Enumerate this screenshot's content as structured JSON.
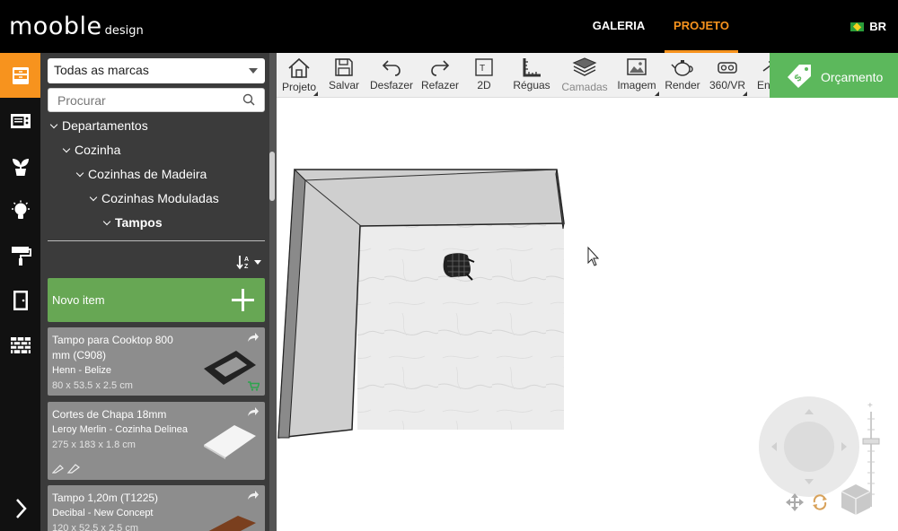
{
  "brand": {
    "logo": "mooble",
    "logo_sub": "design"
  },
  "nav": {
    "gallery": "GALERIA",
    "project": "PROJETO",
    "lang": "BR"
  },
  "catalog": {
    "brand_filter": "Todas as marcas",
    "search_placeholder": "Procurar",
    "tree": [
      "Departamentos",
      "Cozinha",
      "Cozinhas de Madeira",
      "Cozinhas Moduladas",
      "Tampos"
    ],
    "new_item": "Novo item",
    "products": [
      {
        "name": "Tampo para Cooktop 800 mm (C908)",
        "brand": "Henn - Belize",
        "dims": "80 x 53.5 x 2.5 cm"
      },
      {
        "name": "Cortes de Chapa 18mm",
        "brand": "Leroy Merlin - Cozinha Delinea",
        "dims": "275 x 183 x 1.8 cm"
      },
      {
        "name": "Tampo 1,20m (T1225)",
        "brand": "Decibal - New Concept",
        "dims": "120 x 52.5 x 2.5 cm"
      }
    ]
  },
  "toolbar": {
    "project": "Projeto",
    "save": "Salvar",
    "undo": "Desfazer",
    "redo": "Refazer",
    "view2d": "2D",
    "rulers": "Réguas",
    "layers": "Camadas",
    "image": "Imagem",
    "render": "Render",
    "vr": "360/VR",
    "enter": "Entrar",
    "budget": "Orçamento"
  },
  "colors": {
    "accent": "#f7931e",
    "green": "#67a754",
    "budget": "#5cb85c"
  }
}
